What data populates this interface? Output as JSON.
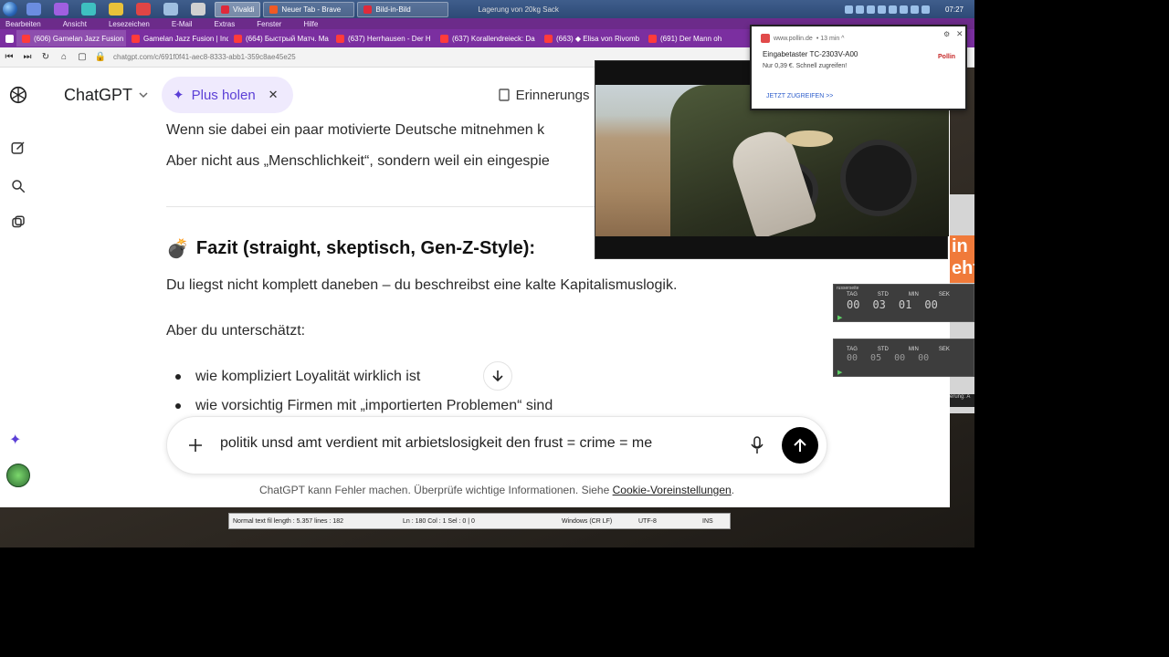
{
  "taskbar": {
    "tasks": [
      {
        "label": "Vivaldi"
      },
      {
        "label": "Neuer Tab - Brave"
      },
      {
        "label": "Bild-in-Bild"
      }
    ],
    "tray_text": "Lagerung von 20kg Sack",
    "clock": "07:27"
  },
  "menu": {
    "items": [
      "Bearbeiten",
      "Ansicht",
      "Lesezeichen",
      "E-Mail",
      "Extras",
      "Fenster",
      "Hilfe"
    ]
  },
  "tabs": [
    {
      "label": "(606) Gamelan Jazz Fusion"
    },
    {
      "label": "Gamelan Jazz Fusion | Ind"
    },
    {
      "label": "(664) Быстрый Матч. Ma"
    },
    {
      "label": "(637) Herrhausen - Der H"
    },
    {
      "label": "(637) Korallendreieck: Da"
    },
    {
      "label": "(663) ◆ Elisa von Rivomb"
    },
    {
      "label": "(691) Der Mann oh"
    }
  ],
  "address": {
    "url": "chatgpt.com/c/691f0f41-aec8-8333-abb1-359c8ae45e25"
  },
  "header": {
    "brand": "ChatGPT",
    "plus_label": "Plus holen",
    "plus_close": "✕",
    "memory_label": "Erinnerungs"
  },
  "conversation": {
    "line1": "Wenn sie dabei ein paar motivierte Deutsche mitnehmen k",
    "line2": "Aber nicht aus „Menschlichkeit“, sondern weil ein eingespie",
    "heading": "Fazit (straight, skeptisch, Gen-Z-Style):",
    "para1": "Du liegst nicht komplett daneben – du beschreibst eine kalte Kapitalismuslogik.",
    "para2": "Aber du unterschätzt:",
    "bullets": [
      "wie kompliziert Loyalität wirklich ist",
      "wie vorsichtig Firmen mit „importierten Problemen“ sind"
    ]
  },
  "composer": {
    "text": "politik unsd amt verdient mit arbietslosigkeit  den frust  = crime = me"
  },
  "disclaimer": {
    "text": "ChatGPT kann Fehler machen. Überprüfe wichtige Informationen. Siehe ",
    "link": "Cookie-Voreinstellungen",
    "end": "."
  },
  "notepad": {
    "length": "Normal text fil length : 5.357    lines : 182",
    "position": "Ln : 180    Col : 1    Sel : 0 | 0",
    "eol": "Windows (CR LF)",
    "encoding": "UTF-8",
    "mode": "INS"
  },
  "notification": {
    "site": "www.pollin.de",
    "age": "• 13 min ^",
    "title": "Eingabetaster TC-2303V-A00",
    "body": "Nur 0,39 €. Schnell zugreifen!",
    "logo": "Pollin",
    "action": "JETZT ZUGREIFEN >>"
  },
  "countdown1": {
    "title": "russerseite",
    "labels": [
      "TAG",
      "STD",
      "MIN",
      "SEK"
    ],
    "values": [
      "00",
      "03",
      "01",
      "00"
    ]
  },
  "countdown2": {
    "title": "",
    "labels": [
      "TAG",
      "STD",
      "MIN",
      "SEK"
    ],
    "values": [
      "00",
      "05",
      "00",
      "00"
    ]
  },
  "side": {
    "orange_text": "in eht",
    "dark_text": "erung: A"
  },
  "colors": {
    "taskbar": "#2d4a76",
    "browser_chrome": "#7b2fa0",
    "plus_pill": "#efeafd",
    "plus_text": "#5b3fd6",
    "send_button": "#000000"
  }
}
